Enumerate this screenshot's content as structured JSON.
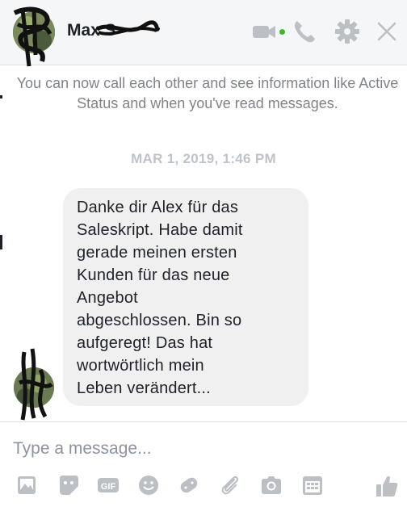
{
  "header": {
    "contact_name": "Max S",
    "status": "active",
    "icons": [
      "video-camera-icon",
      "phone-icon",
      "gear-icon",
      "close-icon"
    ]
  },
  "conversation": {
    "info_text": "You can now call each other and see information like Active Status and when you've read messages.",
    "timestamp": "MAR 1, 2019, 1:46 PM",
    "message": {
      "lines": [
        "Danke dir Alex für das",
        "Saleskript. Habe damit",
        "gerade meinen ersten",
        "Kunden für das neue",
        "Angebot",
        "abgeschlossen. Bin so",
        "aufgeregt! Das hat",
        "wortwörtlich mein",
        "Leben verändert..."
      ]
    }
  },
  "composer": {
    "placeholder": "Type a message...",
    "value": "",
    "tools": [
      "image-icon",
      "sticker-icon",
      "gif-icon",
      "emoji-icon",
      "games-icon",
      "attachment-icon",
      "camera-icon",
      "calendar-icon",
      "thumbs-up-icon"
    ]
  },
  "colors": {
    "accent_blue": "#bec3c9",
    "icon_gray": "#bcc0c4",
    "active_green": "#42b72a",
    "bubble_bg": "#f1f0f0"
  }
}
